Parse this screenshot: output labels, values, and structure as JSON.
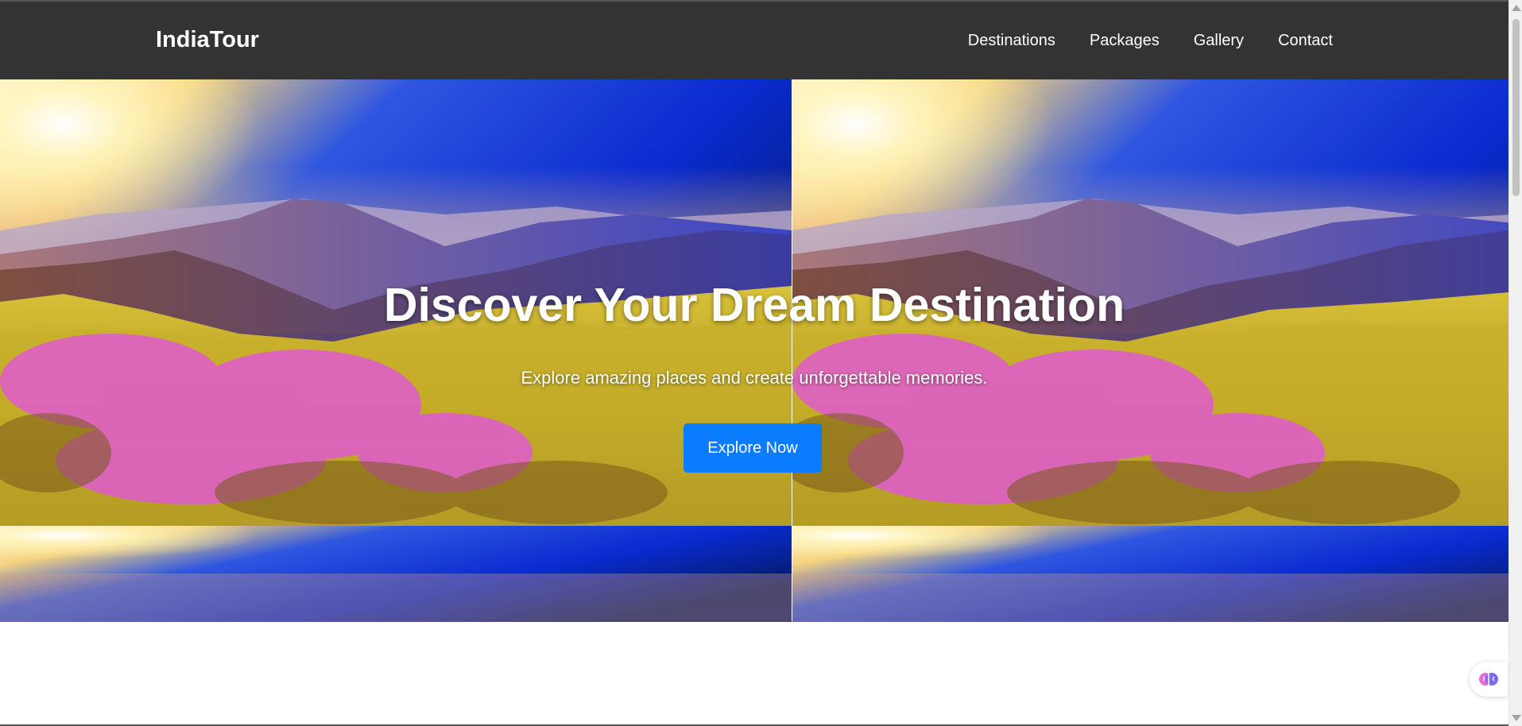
{
  "header": {
    "logo": "IndiaTour",
    "nav": {
      "destinations": "Destinations",
      "packages": "Packages",
      "gallery": "Gallery",
      "contact": "Contact"
    }
  },
  "hero": {
    "title": "Discover Your Dream Destination",
    "subtitle": "Explore amazing places and create unforgettable memories.",
    "cta_label": "Explore Now",
    "background_image": "mountain-flower-meadow-sunrise",
    "cta_color": "#0a7cff"
  },
  "colors": {
    "header_bg": "#333333",
    "text_light": "#ffffff"
  },
  "widget": {
    "icon": "brain-icon"
  }
}
